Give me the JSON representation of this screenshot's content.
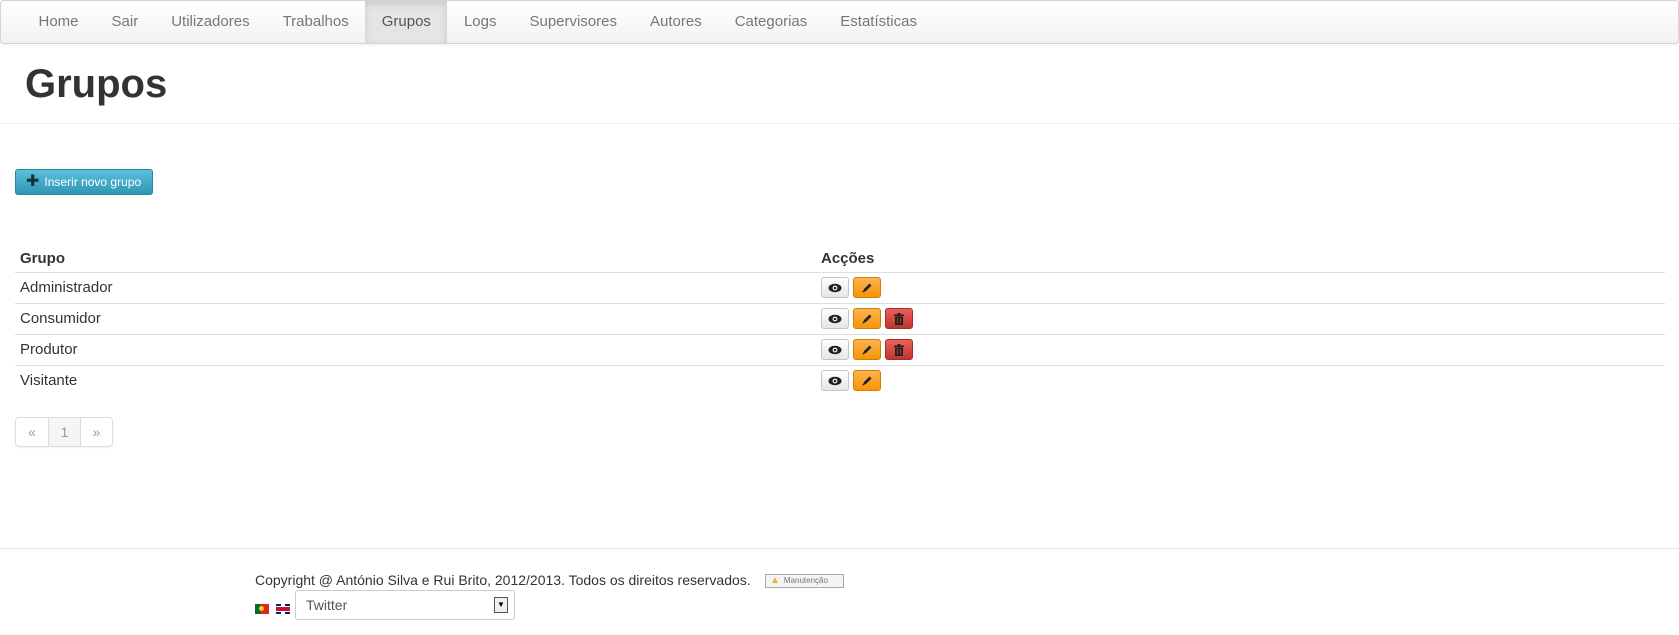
{
  "nav": {
    "items": [
      {
        "label": "Home"
      },
      {
        "label": "Sair"
      },
      {
        "label": "Utilizadores"
      },
      {
        "label": "Trabalhos"
      },
      {
        "label": "Grupos",
        "active": true
      },
      {
        "label": "Logs"
      },
      {
        "label": "Supervisores"
      },
      {
        "label": "Autores"
      },
      {
        "label": "Categorias"
      },
      {
        "label": "Estatísticas"
      }
    ]
  },
  "page": {
    "title": "Grupos",
    "insert_button_label": "Inserir novo grupo",
    "insert_button_icon": "plus-icon"
  },
  "table": {
    "headers": {
      "group": "Grupo",
      "actions": "Acções"
    },
    "rows": [
      {
        "name": "Administrador",
        "actions": [
          "view",
          "edit"
        ]
      },
      {
        "name": "Consumidor",
        "actions": [
          "view",
          "edit",
          "delete"
        ]
      },
      {
        "name": "Produtor",
        "actions": [
          "view",
          "edit",
          "delete"
        ]
      },
      {
        "name": "Visitante",
        "actions": [
          "view",
          "edit"
        ]
      }
    ]
  },
  "pagination": {
    "prev": "«",
    "page": "1",
    "next": "»"
  },
  "footer": {
    "copyright": "Copyright @ António Silva e Rui Brito, 2012/2013. Todos os direitos reservados.",
    "maintenance_badge": "Manutenção",
    "languages": [
      "pt",
      "en"
    ],
    "select_value": "Twitter"
  },
  "colors": {
    "info_button": "#2f96b4",
    "warning_button": "#f89406",
    "danger_button": "#bd362f"
  }
}
